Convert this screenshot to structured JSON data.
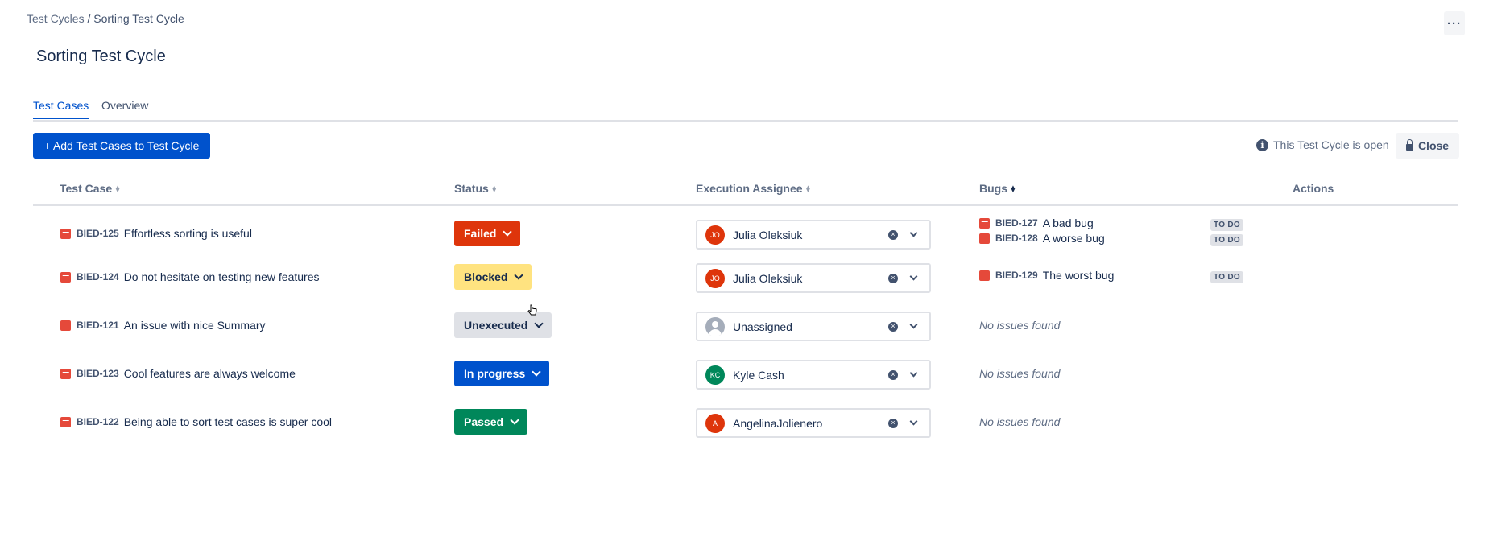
{
  "breadcrumb": {
    "parent": "Test Cycles",
    "separator": " / ",
    "current": "Sorting Test Cycle"
  },
  "header": {
    "more_label": "···"
  },
  "page_title": "Sorting Test Cycle",
  "tabs": [
    {
      "label": "Test Cases",
      "active": true
    },
    {
      "label": "Overview",
      "active": false
    }
  ],
  "toolbar": {
    "add_label": "+ Add Test Cases to Test Cycle",
    "open_status": "This Test Cycle is open",
    "close_label": "Close"
  },
  "table": {
    "headers": {
      "test_case": "Test Case",
      "status": "Status",
      "assignee": "Execution Assignee",
      "bugs": "Bugs",
      "actions": "Actions"
    },
    "rows": [
      {
        "key": "BIED-125",
        "summary": "Effortless sorting is useful",
        "status": "Failed",
        "assignee": {
          "name": "Julia Oleksiuk",
          "initials": "JO"
        },
        "bugs": [
          {
            "key": "BIED-127",
            "summary": "A bad bug",
            "state": "TO DO"
          },
          {
            "key": "BIED-128",
            "summary": "A worse bug",
            "state": "TO DO"
          }
        ]
      },
      {
        "key": "BIED-124",
        "summary": "Do not hesitate on testing new features",
        "status": "Blocked",
        "assignee": {
          "name": "Julia Oleksiuk",
          "initials": "JO"
        },
        "bugs": [
          {
            "key": "BIED-129",
            "summary": "The worst bug",
            "state": "TO DO"
          }
        ]
      },
      {
        "key": "BIED-121",
        "summary": "An issue with nice Summary",
        "status": "Unexecuted",
        "assignee": {
          "name": "Unassigned",
          "initials": ""
        },
        "no_bugs": "No issues found"
      },
      {
        "key": "BIED-123",
        "summary": "Cool features are always welcome",
        "status": "In progress",
        "assignee": {
          "name": "Kyle Cash",
          "initials": "KC"
        },
        "no_bugs": "No issues found"
      },
      {
        "key": "BIED-122",
        "summary": "Being able to sort test cases is super cool",
        "status": "Passed",
        "assignee": {
          "name": "AngelinaJolienero",
          "initials": "A"
        },
        "no_bugs": "No issues found"
      }
    ]
  },
  "colors": {
    "primary": "#0052cc",
    "failed": "#de350b",
    "blocked": "#ffe380",
    "unexecuted": "#dfe1e6",
    "in_progress": "#0052cc",
    "passed": "#00875a",
    "avatar_jo": "#de350b",
    "avatar_kc": "#00875a",
    "avatar_a": "#de350b"
  }
}
